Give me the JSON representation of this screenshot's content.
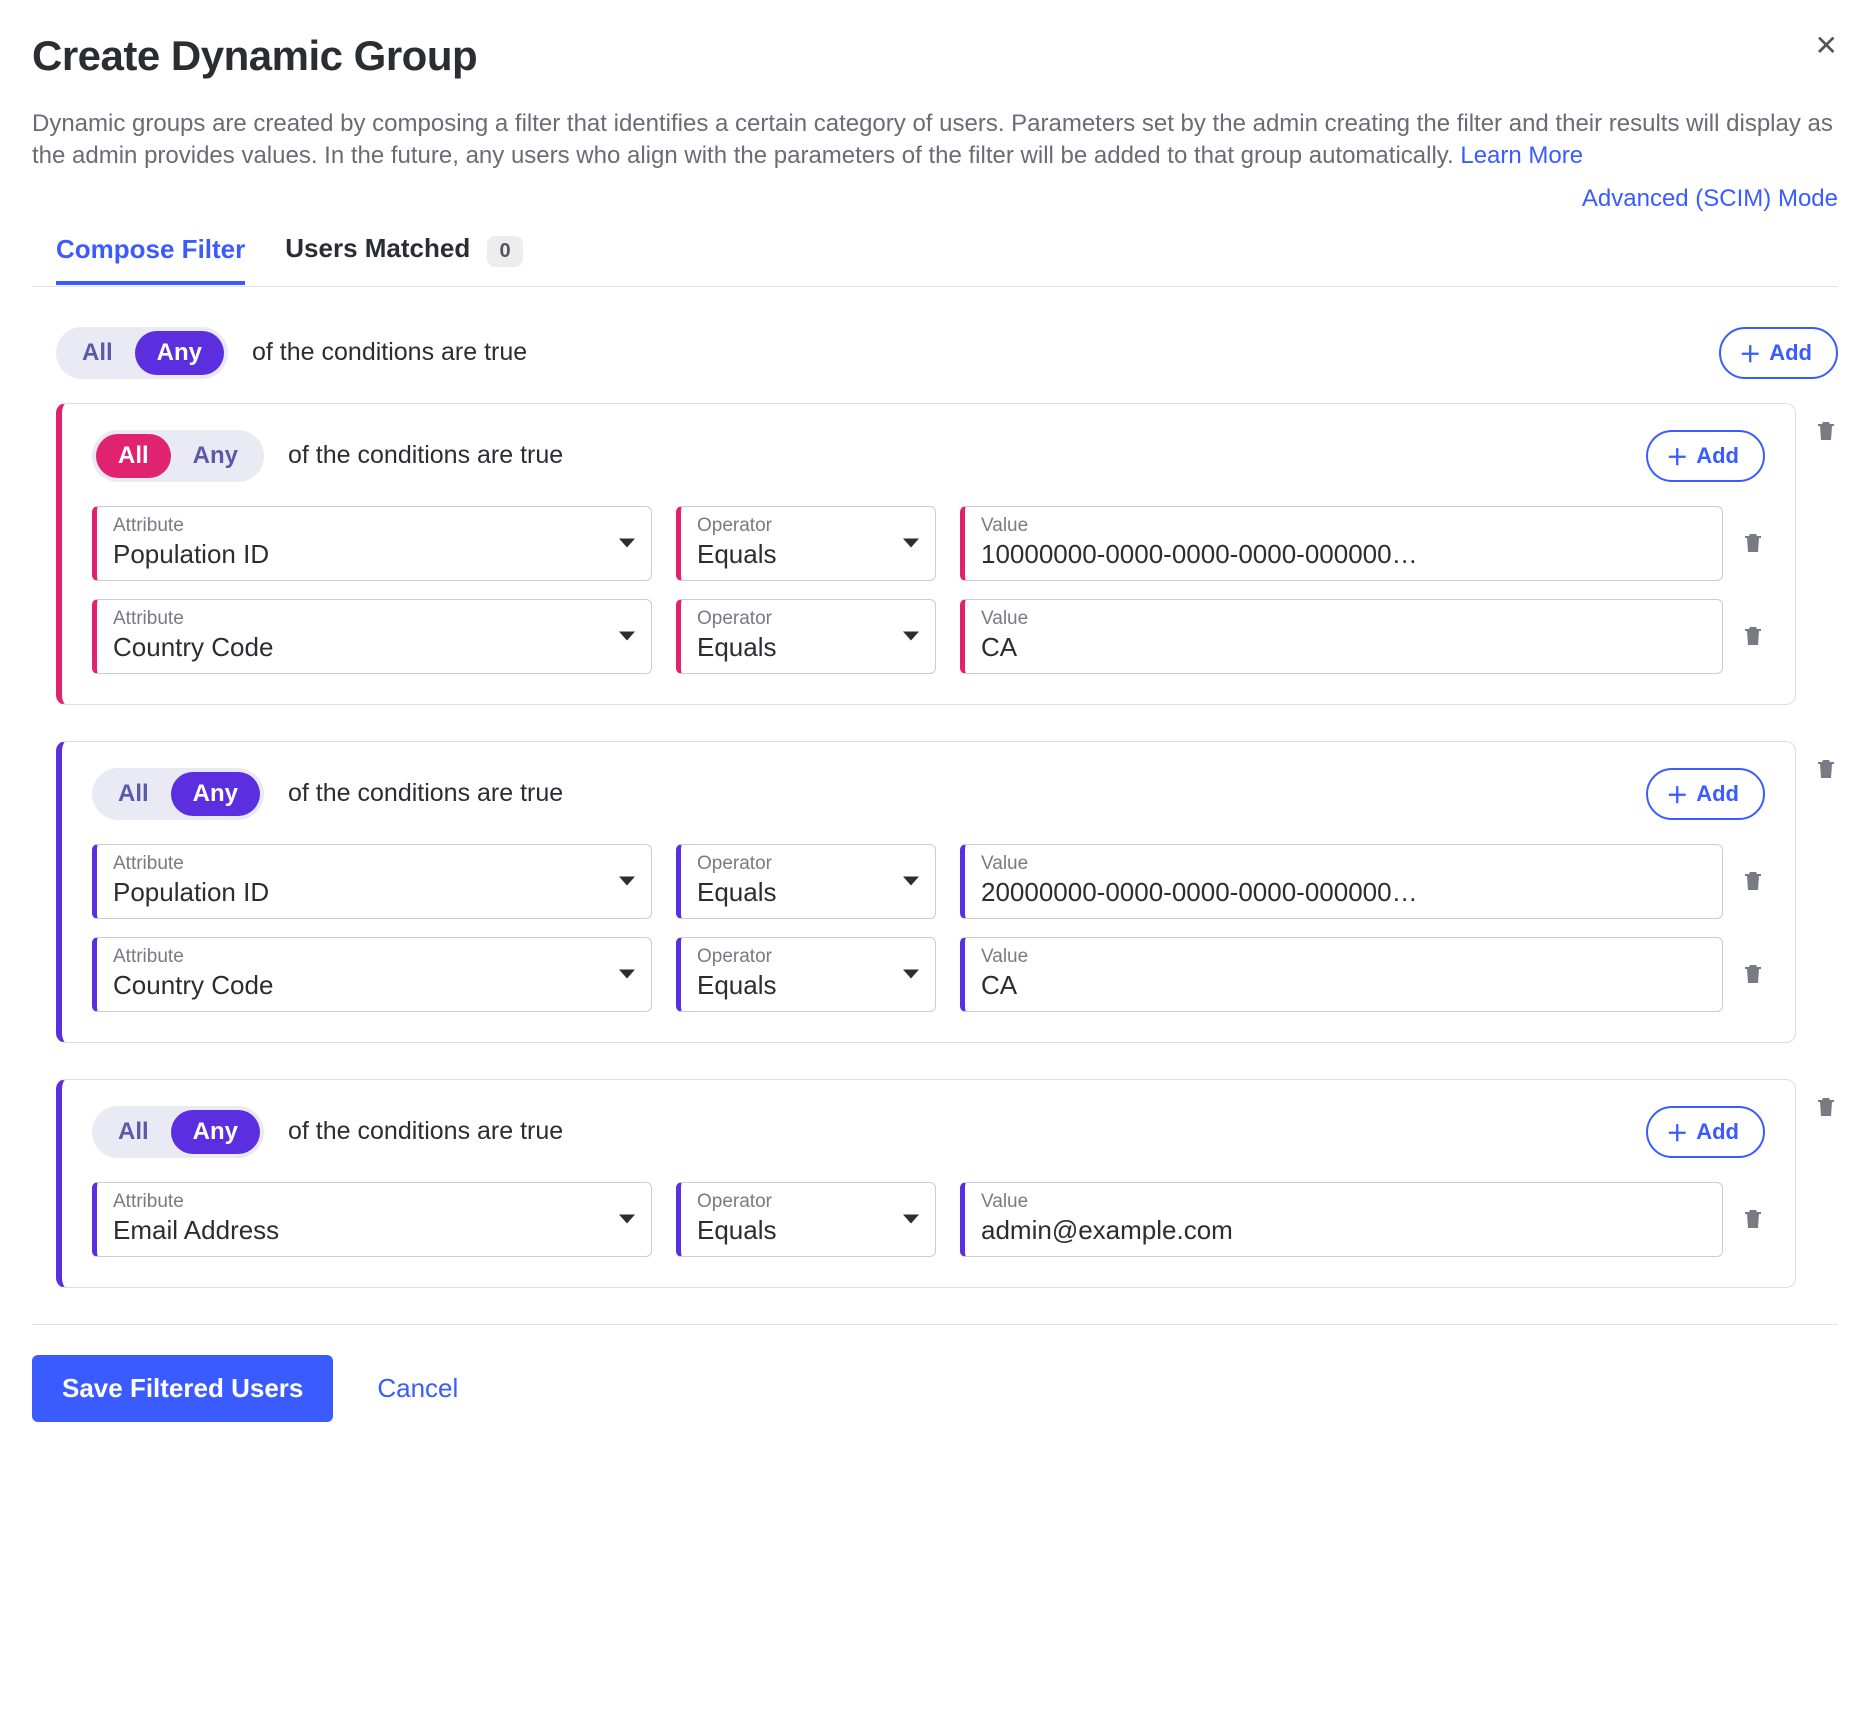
{
  "header": {
    "title": "Create Dynamic Group",
    "description": "Dynamic groups are created by composing a filter that identifies a certain category of users. Parameters set by the admin creating the filter and their results will display as the admin provides values. In the future, any users who align with the parameters of the filter will be added to that group automatically. ",
    "learn_more": "Learn More",
    "mode_link": "Advanced (SCIM) Mode"
  },
  "tabs": {
    "compose": "Compose Filter",
    "matched": "Users Matched",
    "matched_count": "0"
  },
  "toggle": {
    "all": "All",
    "any": "Any",
    "suffix": "of the conditions are true",
    "add": "Add"
  },
  "labels": {
    "attribute": "Attribute",
    "operator": "Operator",
    "value": "Value"
  },
  "groups": [
    {
      "accent": "pink",
      "selected": "all",
      "conditions": [
        {
          "attribute": "Population ID",
          "operator": "Equals",
          "value": "10000000-0000-0000-0000-000000…"
        },
        {
          "attribute": "Country Code",
          "operator": "Equals",
          "value": "CA"
        }
      ]
    },
    {
      "accent": "purple",
      "selected": "any",
      "conditions": [
        {
          "attribute": "Population ID",
          "operator": "Equals",
          "value": "20000000-0000-0000-0000-000000…"
        },
        {
          "attribute": "Country Code",
          "operator": "Equals",
          "value": "CA"
        }
      ]
    },
    {
      "accent": "purple",
      "selected": "any",
      "conditions": [
        {
          "attribute": "Email Address",
          "operator": "Equals",
          "value": "admin@example.com"
        }
      ]
    }
  ],
  "footer": {
    "save": "Save Filtered Users",
    "cancel": "Cancel"
  }
}
